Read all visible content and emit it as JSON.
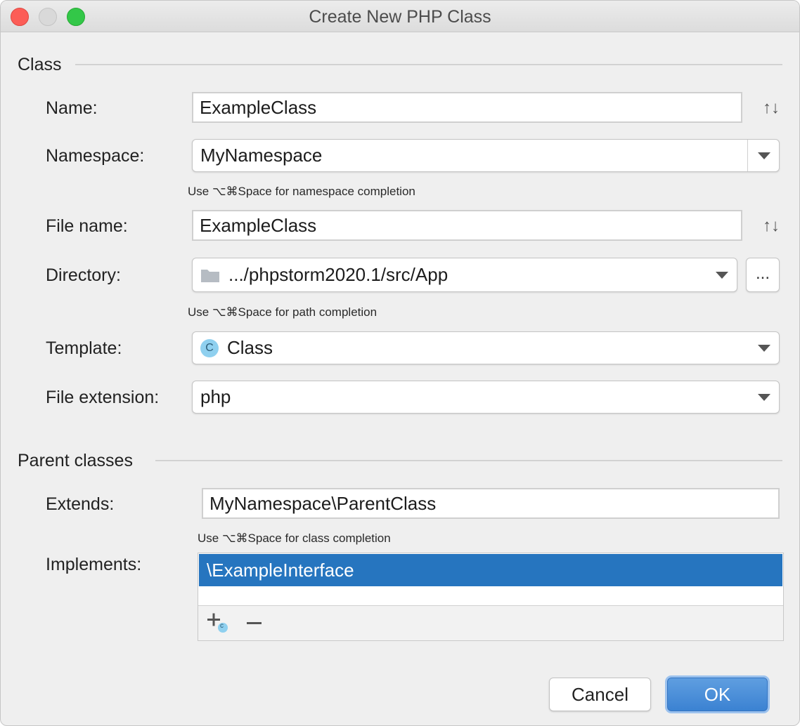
{
  "window": {
    "title": "Create New PHP Class"
  },
  "class_section": {
    "header": "Class",
    "name": {
      "label": "Name:",
      "value": "ExampleClass"
    },
    "namespace": {
      "label": "Namespace:",
      "value": "MyNamespace",
      "hint": "Use ⌥⌘Space for namespace completion"
    },
    "file_name": {
      "label": "File name:",
      "value": "ExampleClass"
    },
    "directory": {
      "label": "Directory:",
      "value": ".../phpstorm2020.1/src/App",
      "hint": "Use ⌥⌘Space for path completion",
      "browse_label": "..."
    },
    "template": {
      "label": "Template:",
      "value": "Class",
      "icon_letter": "C"
    },
    "file_extension": {
      "label": "File extension:",
      "value": "php"
    }
  },
  "parent_section": {
    "header": "Parent classes",
    "extends": {
      "label": "Extends:",
      "value": "MyNamespace\\ParentClass",
      "hint": "Use ⌥⌘Space for class completion"
    },
    "implements": {
      "label": "Implements:",
      "items": [
        "\\ExampleInterface"
      ],
      "add_badge": "c"
    }
  },
  "buttons": {
    "cancel": "Cancel",
    "ok": "OK"
  },
  "icons": {
    "sort": "↑↓",
    "selection_color": "#2675bf",
    "ok_color": "#4a8fd8"
  }
}
